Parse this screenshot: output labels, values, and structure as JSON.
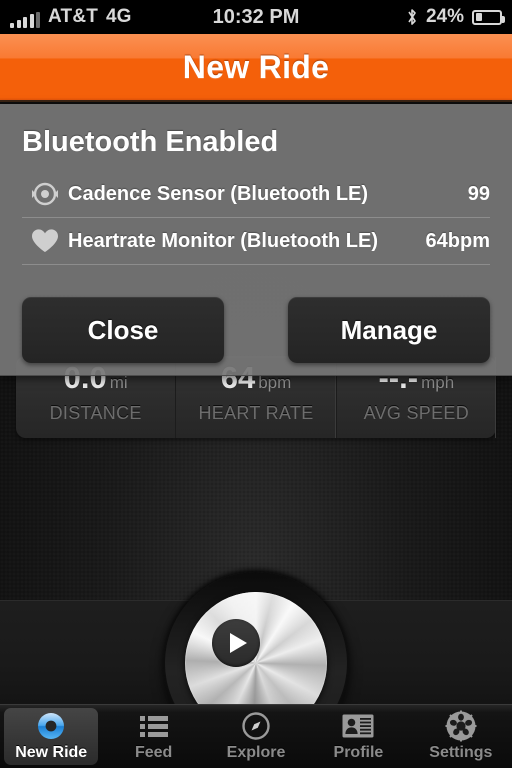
{
  "statusbar": {
    "carrier": "AT&T",
    "network": "4G",
    "time": "10:32 PM",
    "battery_percent": "24%",
    "bluetooth_icon": "bluetooth-icon",
    "signal_icon": "signal-bars-icon",
    "battery_icon": "battery-icon"
  },
  "navbar": {
    "title": "New Ride",
    "accent_color": "#f4600a"
  },
  "modal": {
    "heading": "Bluetooth Enabled",
    "sensors": [
      {
        "icon": "cadence-icon",
        "name": "Cadence Sensor (Bluetooth LE)",
        "value": "99"
      },
      {
        "icon": "heart-icon",
        "name": "Heartrate Monitor (Bluetooth LE)",
        "value": "64bpm"
      }
    ],
    "close_label": "Close",
    "manage_label": "Manage"
  },
  "stats": [
    {
      "value": "0.0",
      "unit": "mi",
      "label": "DISTANCE"
    },
    {
      "value": "64",
      "unit": "bpm",
      "label": "HEART RATE"
    },
    {
      "value": "--.-",
      "unit": "mph",
      "label": "AVG SPEED"
    }
  ],
  "record": {
    "icon": "play-icon",
    "label": "Start Ride"
  },
  "tabbar": {
    "items": [
      {
        "label": "New Ride",
        "icon": "ride-ring-icon",
        "active": true
      },
      {
        "label": "Feed",
        "icon": "list-icon",
        "active": false
      },
      {
        "label": "Explore",
        "icon": "compass-icon",
        "active": false
      },
      {
        "label": "Profile",
        "icon": "contact-card-icon",
        "active": false
      },
      {
        "label": "Settings",
        "icon": "chainring-icon",
        "active": false
      }
    ]
  }
}
